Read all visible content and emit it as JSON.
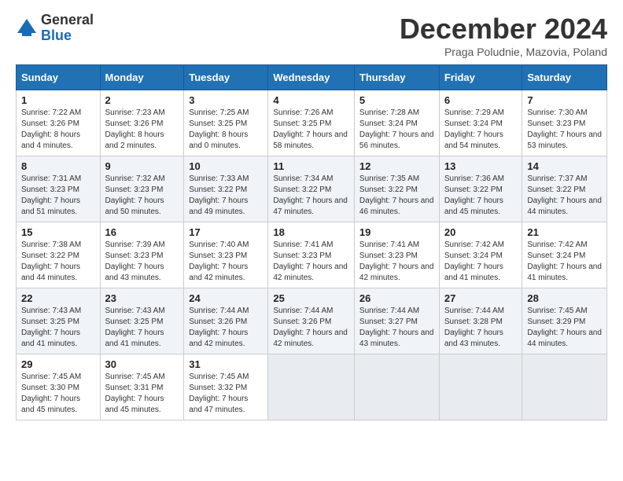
{
  "logo": {
    "general": "General",
    "blue": "Blue"
  },
  "title": "December 2024",
  "subtitle": "Praga Poludnie, Mazovia, Poland",
  "headers": [
    "Sunday",
    "Monday",
    "Tuesday",
    "Wednesday",
    "Thursday",
    "Friday",
    "Saturday"
  ],
  "weeks": [
    [
      {
        "day": "1",
        "sunrise": "7:22 AM",
        "sunset": "3:26 PM",
        "daylight": "8 hours and 4 minutes."
      },
      {
        "day": "2",
        "sunrise": "7:23 AM",
        "sunset": "3:26 PM",
        "daylight": "8 hours and 2 minutes."
      },
      {
        "day": "3",
        "sunrise": "7:25 AM",
        "sunset": "3:25 PM",
        "daylight": "8 hours and 0 minutes."
      },
      {
        "day": "4",
        "sunrise": "7:26 AM",
        "sunset": "3:25 PM",
        "daylight": "7 hours and 58 minutes."
      },
      {
        "day": "5",
        "sunrise": "7:28 AM",
        "sunset": "3:24 PM",
        "daylight": "7 hours and 56 minutes."
      },
      {
        "day": "6",
        "sunrise": "7:29 AM",
        "sunset": "3:24 PM",
        "daylight": "7 hours and 54 minutes."
      },
      {
        "day": "7",
        "sunrise": "7:30 AM",
        "sunset": "3:23 PM",
        "daylight": "7 hours and 53 minutes."
      }
    ],
    [
      {
        "day": "8",
        "sunrise": "7:31 AM",
        "sunset": "3:23 PM",
        "daylight": "7 hours and 51 minutes."
      },
      {
        "day": "9",
        "sunrise": "7:32 AM",
        "sunset": "3:23 PM",
        "daylight": "7 hours and 50 minutes."
      },
      {
        "day": "10",
        "sunrise": "7:33 AM",
        "sunset": "3:22 PM",
        "daylight": "7 hours and 49 minutes."
      },
      {
        "day": "11",
        "sunrise": "7:34 AM",
        "sunset": "3:22 PM",
        "daylight": "7 hours and 47 minutes."
      },
      {
        "day": "12",
        "sunrise": "7:35 AM",
        "sunset": "3:22 PM",
        "daylight": "7 hours and 46 minutes."
      },
      {
        "day": "13",
        "sunrise": "7:36 AM",
        "sunset": "3:22 PM",
        "daylight": "7 hours and 45 minutes."
      },
      {
        "day": "14",
        "sunrise": "7:37 AM",
        "sunset": "3:22 PM",
        "daylight": "7 hours and 44 minutes."
      }
    ],
    [
      {
        "day": "15",
        "sunrise": "7:38 AM",
        "sunset": "3:22 PM",
        "daylight": "7 hours and 44 minutes."
      },
      {
        "day": "16",
        "sunrise": "7:39 AM",
        "sunset": "3:23 PM",
        "daylight": "7 hours and 43 minutes."
      },
      {
        "day": "17",
        "sunrise": "7:40 AM",
        "sunset": "3:23 PM",
        "daylight": "7 hours and 42 minutes."
      },
      {
        "day": "18",
        "sunrise": "7:41 AM",
        "sunset": "3:23 PM",
        "daylight": "7 hours and 42 minutes."
      },
      {
        "day": "19",
        "sunrise": "7:41 AM",
        "sunset": "3:23 PM",
        "daylight": "7 hours and 42 minutes."
      },
      {
        "day": "20",
        "sunrise": "7:42 AM",
        "sunset": "3:24 PM",
        "daylight": "7 hours and 41 minutes."
      },
      {
        "day": "21",
        "sunrise": "7:42 AM",
        "sunset": "3:24 PM",
        "daylight": "7 hours and 41 minutes."
      }
    ],
    [
      {
        "day": "22",
        "sunrise": "7:43 AM",
        "sunset": "3:25 PM",
        "daylight": "7 hours and 41 minutes."
      },
      {
        "day": "23",
        "sunrise": "7:43 AM",
        "sunset": "3:25 PM",
        "daylight": "7 hours and 41 minutes."
      },
      {
        "day": "24",
        "sunrise": "7:44 AM",
        "sunset": "3:26 PM",
        "daylight": "7 hours and 42 minutes."
      },
      {
        "day": "25",
        "sunrise": "7:44 AM",
        "sunset": "3:26 PM",
        "daylight": "7 hours and 42 minutes."
      },
      {
        "day": "26",
        "sunrise": "7:44 AM",
        "sunset": "3:27 PM",
        "daylight": "7 hours and 43 minutes."
      },
      {
        "day": "27",
        "sunrise": "7:44 AM",
        "sunset": "3:28 PM",
        "daylight": "7 hours and 43 minutes."
      },
      {
        "day": "28",
        "sunrise": "7:45 AM",
        "sunset": "3:29 PM",
        "daylight": "7 hours and 44 minutes."
      }
    ],
    [
      {
        "day": "29",
        "sunrise": "7:45 AM",
        "sunset": "3:30 PM",
        "daylight": "7 hours and 45 minutes."
      },
      {
        "day": "30",
        "sunrise": "7:45 AM",
        "sunset": "3:31 PM",
        "daylight": "7 hours and 45 minutes."
      },
      {
        "day": "31",
        "sunrise": "7:45 AM",
        "sunset": "3:32 PM",
        "daylight": "7 hours and 47 minutes."
      },
      null,
      null,
      null,
      null
    ]
  ],
  "labels": {
    "sunrise": "Sunrise:",
    "sunset": "Sunset:",
    "daylight": "Daylight:"
  }
}
